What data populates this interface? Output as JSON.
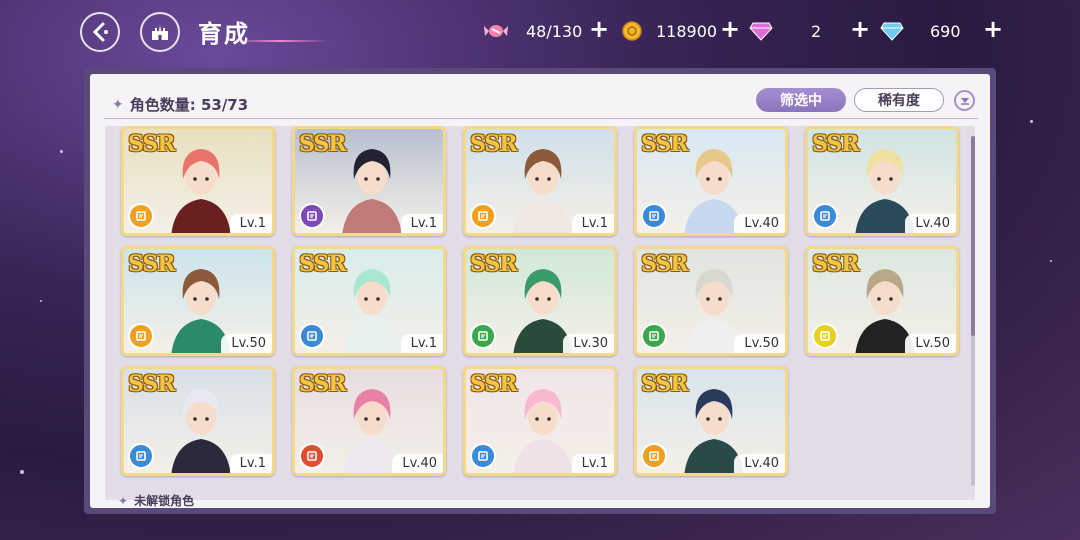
{
  "header": {
    "back_icon": "back-arrow-icon",
    "home_icon": "castle-icon",
    "title": "育成"
  },
  "resources": [
    {
      "icon": "candy-icon",
      "value": "48/130",
      "color": "#ff7fb0"
    },
    {
      "icon": "gold-coin-icon",
      "value": "118900",
      "color": "#f5b82a"
    },
    {
      "icon": "pink-diamond-icon",
      "value": "2",
      "color": "#e06cd8"
    },
    {
      "icon": "blue-diamond-icon",
      "value": "690",
      "color": "#6ccdf0"
    }
  ],
  "panel": {
    "count_label": "角色数量: 53/73",
    "filter_label": "筛选中",
    "rarity_label": "稀有度",
    "sort_icon": "sort-toggle-icon",
    "locked_label": "未解锁角色"
  },
  "cards": [
    {
      "rarity": "SSR",
      "level": "Lv.1",
      "attr_color": "#f0a020",
      "hair": "#e8746a",
      "outfit": "#6a2020",
      "bg": "#e8e0c0"
    },
    {
      "rarity": "SSR",
      "level": "Lv.1",
      "attr_color": "#7a4ab8",
      "hair": "#222233",
      "outfit": "#c07a7a",
      "bg": "#b8c0d0"
    },
    {
      "rarity": "SSR",
      "level": "Lv.1",
      "attr_color": "#f0a020",
      "hair": "#8a5a3a",
      "outfit": "#f0e8e0",
      "bg": "#d0e0ea"
    },
    {
      "rarity": "SSR",
      "level": "Lv.40",
      "attr_color": "#3a8ad8",
      "hair": "#e8c888",
      "outfit": "#c8d8f0",
      "bg": "#d8e8f4"
    },
    {
      "rarity": "SSR",
      "level": "Lv.40",
      "attr_color": "#3a8ad8",
      "hair": "#f0e0a0",
      "outfit": "#2a4a5a",
      "bg": "#d0e4e4"
    },
    {
      "rarity": "SSR",
      "level": "Lv.50",
      "attr_color": "#f0a020",
      "hair": "#8a5a3a",
      "outfit": "#2a8a6a",
      "bg": "#cce4ec"
    },
    {
      "rarity": "SSR",
      "level": "Lv.1",
      "attr_color": "#3a8ad8",
      "hair": "#a8e8d0",
      "outfit": "#e8f0f0",
      "bg": "#d8ecec"
    },
    {
      "rarity": "SSR",
      "level": "Lv.30",
      "attr_color": "#3aa84a",
      "hair": "#3a9a6a",
      "outfit": "#2a4a3a",
      "bg": "#d0e8d8"
    },
    {
      "rarity": "SSR",
      "level": "Lv.50",
      "attr_color": "#3aa84a",
      "hair": "#d8d8d0",
      "outfit": "#f0f0f0",
      "bg": "#e0e4e0"
    },
    {
      "rarity": "SSR",
      "level": "Lv.50",
      "attr_color": "#e8d020",
      "hair": "#b8a888",
      "outfit": "#222222",
      "bg": "#dce8e0"
    },
    {
      "rarity": "SSR",
      "level": "Lv.1",
      "attr_color": "#3a8ad8",
      "hair": "#e8e8f0",
      "outfit": "#2a2a3a",
      "bg": "#d8e0e8"
    },
    {
      "rarity": "SSR",
      "level": "Lv.40",
      "attr_color": "#e05030",
      "hair": "#e880a8",
      "outfit": "#f0e8f0",
      "bg": "#e8dce0"
    },
    {
      "rarity": "SSR",
      "level": "Lv.1",
      "attr_color": "#3a8ad8",
      "hair": "#f8b8d0",
      "outfit": "#f0e0e8",
      "bg": "#f0e4e8"
    },
    {
      "rarity": "SSR",
      "level": "Lv.40",
      "attr_color": "#f0a020",
      "hair": "#2a3a5a",
      "outfit": "#2a4a4a",
      "bg": "#d8e4ec"
    }
  ]
}
